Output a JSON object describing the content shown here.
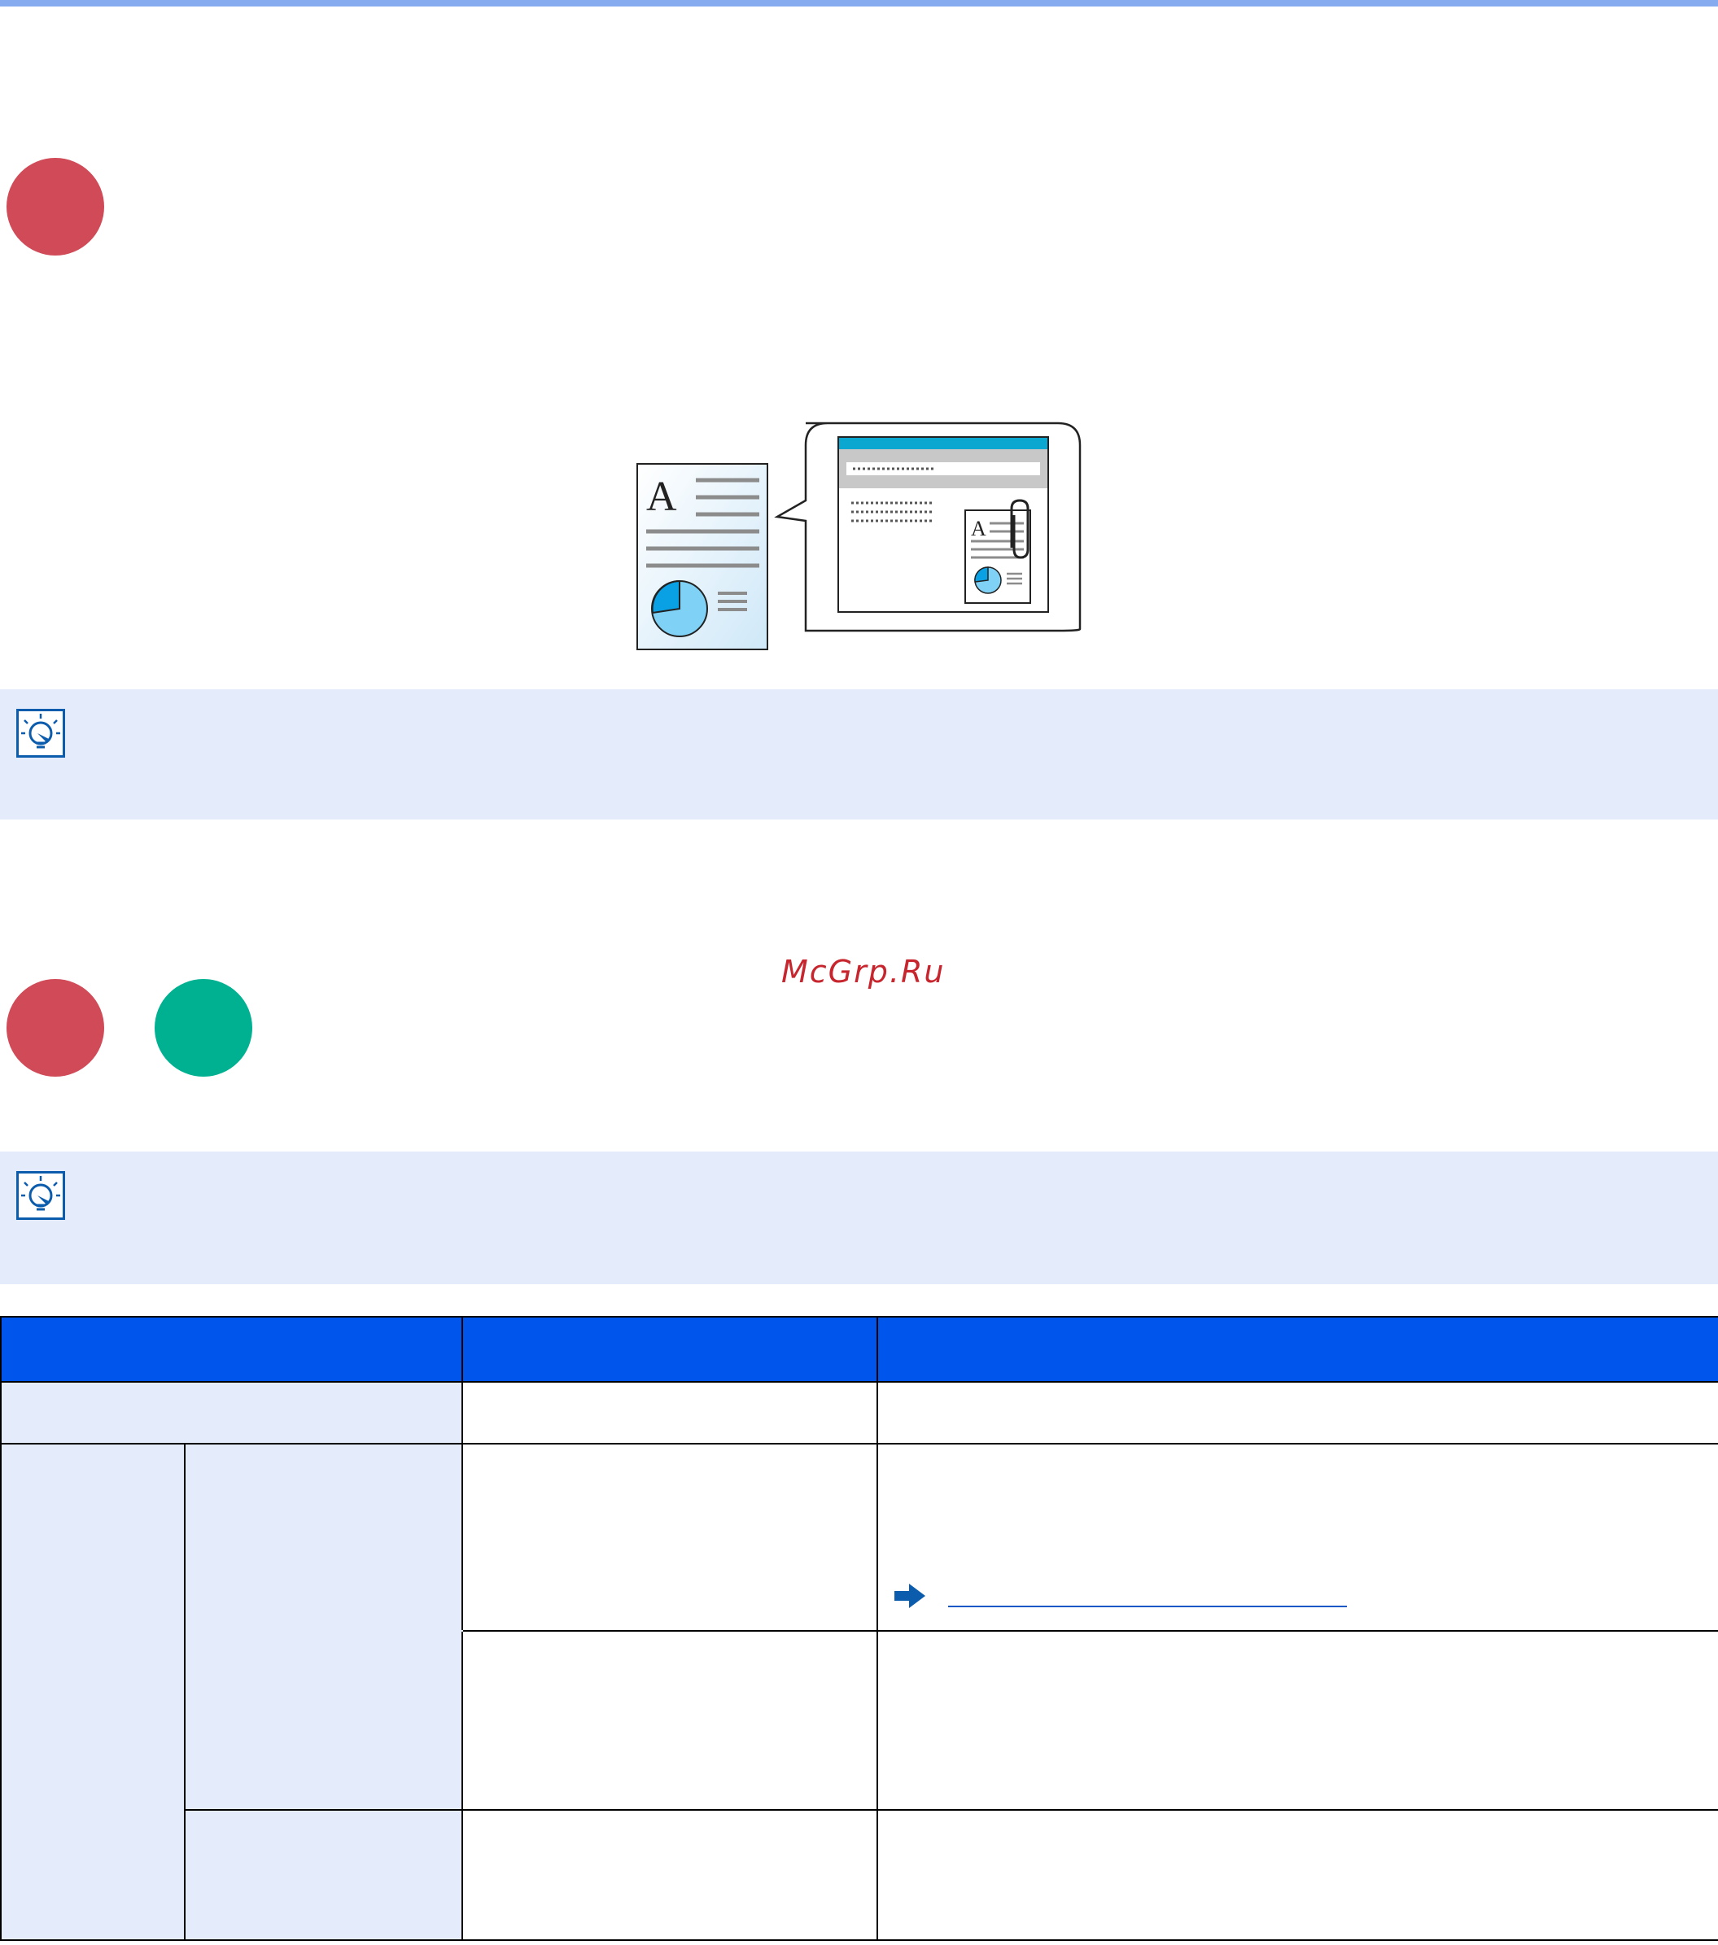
{
  "colors": {
    "top_rule": "#86abef",
    "dot_red": "#d04a57",
    "dot_green": "#00b191",
    "note_bg": "#e4ecfb",
    "icon_blue": "#0b5cad",
    "table_header": "#0055ec",
    "table_label": "#e4ecfb",
    "link": "#1458c8",
    "watermark": "#c8262e"
  },
  "icons": {
    "tip": "lightbulb-icon",
    "link_arrow": "arrow-right-icon"
  },
  "watermark": "McGrp.Ru"
}
